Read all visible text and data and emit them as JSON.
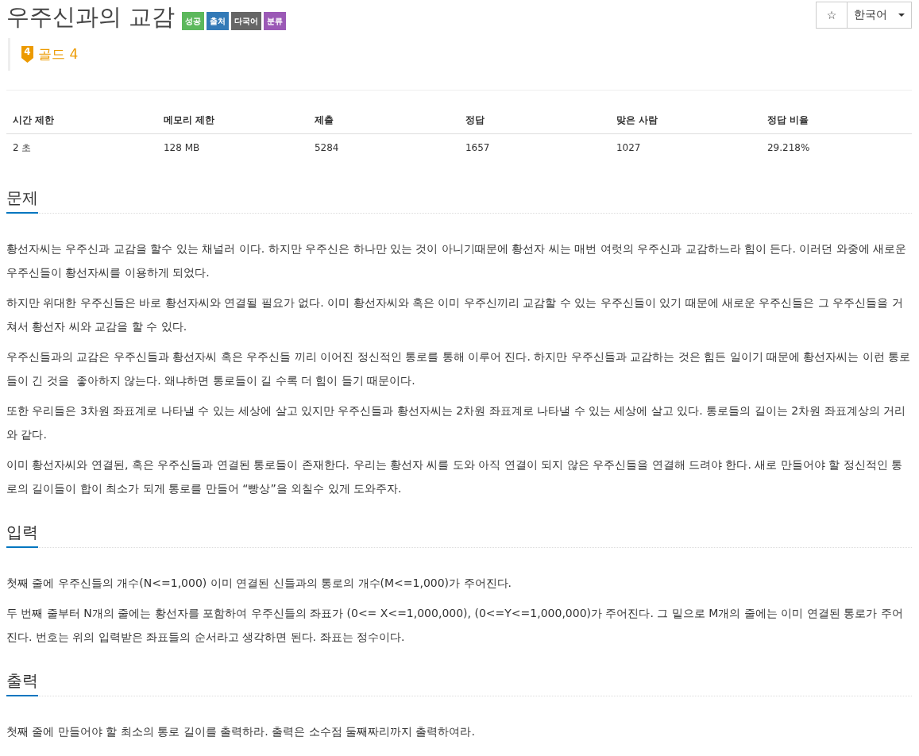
{
  "title": "우주신과의 교감",
  "labels": [
    {
      "text": "성공",
      "color": "#5cb85c"
    },
    {
      "text": "출처",
      "color": "#337ab7"
    },
    {
      "text": "다국어",
      "color": "#666666"
    },
    {
      "text": "분류",
      "color": "#9b59b6"
    }
  ],
  "tier": {
    "number": "4",
    "label": "골드 4"
  },
  "actions": {
    "star": "☆",
    "language": "한국어"
  },
  "stats": {
    "columns": [
      "시간 제한",
      "메모리 제한",
      "제출",
      "정답",
      "맞은 사람",
      "정답 비율"
    ],
    "rows": [
      [
        "2 초",
        "128 MB",
        "5284",
        "1657",
        "1027",
        "29.218%"
      ]
    ]
  },
  "sections": [
    {
      "heading": "문제",
      "paragraphs": [
        "황선자씨는 우주신과 교감을 할수 있는 채널러 이다. 하지만 우주신은 하나만 있는 것이 아니기때문에 황선자 씨는 매번 여럿의 우주신과 교감하느라 힘이 든다. 이러던 와중에 새로운 우주신들이 황선자씨를 이용하게 되었다.",
        "하지만 위대한 우주신들은 바로 황선자씨와 연결될 필요가 없다. 이미 황선자씨와 혹은 이미 우주신끼리 교감할 수 있는 우주신들이 있기 때문에 새로운 우주신들은 그 우주신들을 거쳐서 황선자 씨와 교감을 할 수 있다.",
        "우주신들과의 교감은 우주신들과 황선자씨 혹은 우주신들 끼리 이어진 정신적인 통로를 통해 이루어 진다. 하지만 우주신들과 교감하는 것은 힘든 일이기 때문에 황선자씨는 이런 통로들이 긴 것을  좋아하지 않는다. 왜냐하면 통로들이 길 수록 더 힘이 들기 때문이다.",
        "또한 우리들은 3차원 좌표계로 나타낼 수 있는 세상에 살고 있지만 우주신들과 황선자씨는 2차원 좌표계로 나타낼 수 있는 세상에 살고 있다. 통로들의 길이는 2차원 좌표계상의 거리와 같다.",
        "이미 황선자씨와 연결된, 혹은 우주신들과 연결된 통로들이 존재한다. 우리는 황선자 씨를 도와 아직 연결이 되지 않은 우주신들을 연결해 드려야 한다. 새로 만들어야 할 정신적인 통로의 길이들이 합이 최소가 되게 통로를 만들어 “빵상”을 외칠수 있게 도와주자."
      ]
    },
    {
      "heading": "입력",
      "paragraphs": [
        "첫째 줄에 우주신들의 개수(N<=1,000) 이미 연결된 신들과의 통로의 개수(M<=1,000)가 주어진다.",
        "두 번째 줄부터 N개의 줄에는 황선자를 포함하여 우주신들의 좌표가 (0<= X<=1,000,000), (0<=Y<=1,000,000)가 주어진다. 그 밑으로 M개의 줄에는 이미 연결된 통로가 주어진다. 번호는 위의 입력받은 좌표들의 순서라고 생각하면 된다. 좌표는 정수이다."
      ]
    },
    {
      "heading": "출력",
      "paragraphs": [
        "첫째 줄에 만들어야 할 최소의 통로 길이를 출력하라. 출력은 소수점 둘째짜리까지 출력하여라."
      ]
    }
  ]
}
